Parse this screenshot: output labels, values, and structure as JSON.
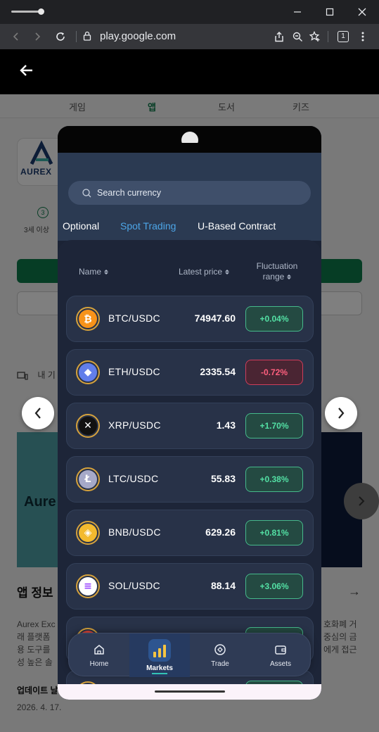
{
  "browser": {
    "url": "play.google.com",
    "tab_count": "1"
  },
  "store": {
    "categories": [
      {
        "label": "게임"
      },
      {
        "label": "앱",
        "active": true
      },
      {
        "label": "도서"
      },
      {
        "label": "키즈"
      }
    ],
    "logo_text": "AUREX",
    "age_rating": "3",
    "age_text": "3세 이상",
    "device_text": "내 기",
    "screenshot_text": "Aure",
    "info_title": "앱 정보",
    "description_left": "Aurex Exc\n래 플랫폼\n용 도구를\n성 높은 솔",
    "description_right": "호화폐 거\n중심의 금\n에게 접근",
    "update_title": "업데이트 날",
    "update_date": "2026. 4. 17."
  },
  "app": {
    "search_placeholder": "Search currency",
    "tabs": [
      {
        "label": "Optional"
      },
      {
        "label": "Spot Trading",
        "active": true
      },
      {
        "label": "U-Based Contract"
      }
    ],
    "columns": {
      "name": "Name",
      "price": "Latest price",
      "change_line1": "Fluctuation",
      "change_line2": "range"
    },
    "rows": [
      {
        "pair": "BTC/USDC",
        "price": "74947.60",
        "change": "+0.04%",
        "direction": "up",
        "icon": "bitcoin-icon",
        "icon_glyph": "₿",
        "icon_bg": "#f7931a",
        "icon_fg": "#ffffff"
      },
      {
        "pair": "ETH/USDC",
        "price": "2335.54",
        "change": "-0.72%",
        "direction": "down",
        "icon": "ethereum-icon",
        "icon_glyph": "◆",
        "icon_bg": "#627eea",
        "icon_fg": "#ffffff"
      },
      {
        "pair": "XRP/USDC",
        "price": "1.43",
        "change": "+1.70%",
        "direction": "up",
        "icon": "xrp-icon",
        "icon_glyph": "✕",
        "icon_bg": "#111111",
        "icon_fg": "#ffffff"
      },
      {
        "pair": "LTC/USDC",
        "price": "55.83",
        "change": "+0.38%",
        "direction": "up",
        "icon": "litecoin-icon",
        "icon_glyph": "Ł",
        "icon_bg": "#a6a9c8",
        "icon_fg": "#ffffff"
      },
      {
        "pair": "BNB/USDC",
        "price": "629.26",
        "change": "+0.81%",
        "direction": "up",
        "icon": "bnb-icon",
        "icon_glyph": "◈",
        "icon_bg": "#f3ba2f",
        "icon_fg": "#ffffff"
      },
      {
        "pair": "SOL/USDC",
        "price": "88.14",
        "change": "+3.06%",
        "direction": "up",
        "icon": "solana-icon",
        "icon_glyph": "≡",
        "icon_bg": "#ffffff",
        "icon_fg": "#9945ff"
      },
      {
        "pair": "",
        "price": "",
        "change": "",
        "direction": "up",
        "icon": "coin-icon",
        "icon_glyph": "",
        "icon_bg": "#e0463a",
        "icon_fg": "#ffffff"
      },
      {
        "pair": "",
        "price": "",
        "change": "",
        "direction": "up",
        "icon": "coin-icon",
        "icon_glyph": "",
        "icon_bg": "#8a8a8a",
        "icon_fg": "#ffffff"
      }
    ],
    "nav": [
      {
        "label": "Home",
        "icon": "home-icon"
      },
      {
        "label": "Markets",
        "icon": "markets-icon",
        "active": true
      },
      {
        "label": "Trade",
        "icon": "trade-icon"
      },
      {
        "label": "Assets",
        "icon": "wallet-icon"
      }
    ]
  },
  "colors": {
    "up": "#53e0a4",
    "down": "#ff5f7e",
    "accent": "#4da6e8",
    "store_green": "#0d7a4b"
  }
}
